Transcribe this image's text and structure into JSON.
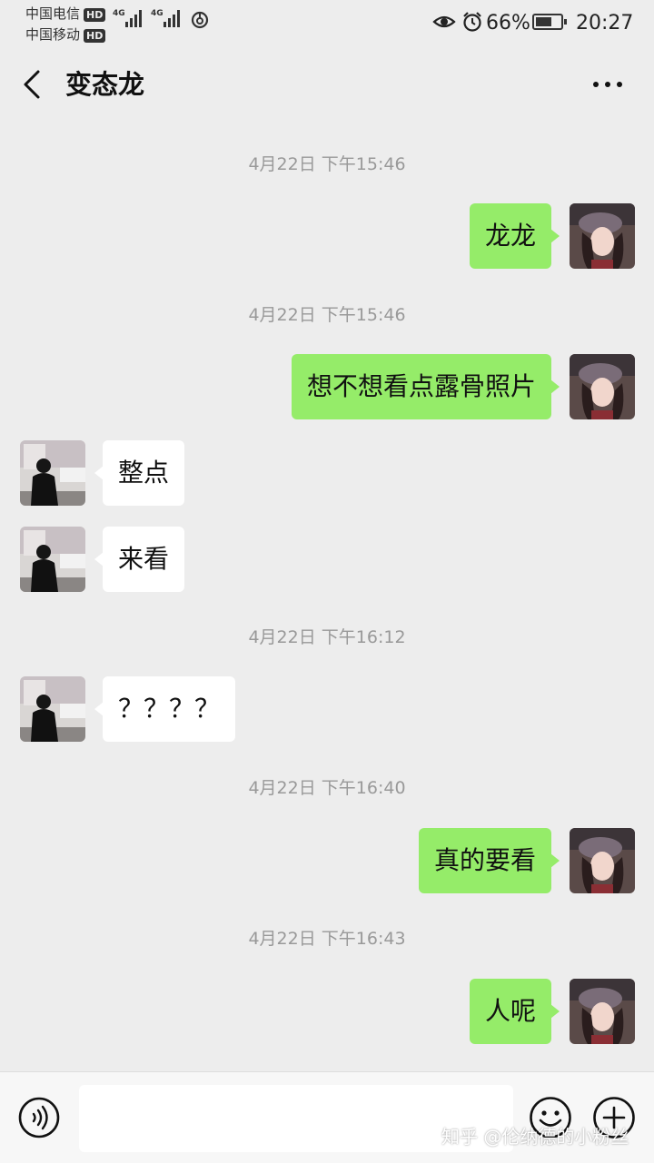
{
  "status_bar": {
    "carrier_1": "中国电信",
    "carrier_2": "中国移动",
    "hd_badge": "HD",
    "network": "4G",
    "battery": "66%",
    "battery_level": 0.66,
    "time": "20:27"
  },
  "header": {
    "title": "变态龙"
  },
  "messages": [
    {
      "type": "time",
      "text": "4月22日 下午15:46"
    },
    {
      "type": "msg",
      "from": "me",
      "text": "龙龙"
    },
    {
      "type": "time",
      "text": "4月22日 下午15:46"
    },
    {
      "type": "msg",
      "from": "me",
      "text": "想不想看点露骨照片"
    },
    {
      "type": "msg",
      "from": "them",
      "text": "整点"
    },
    {
      "type": "msg",
      "from": "them",
      "text": "来看"
    },
    {
      "type": "time",
      "text": "4月22日 下午16:12"
    },
    {
      "type": "msg",
      "from": "them",
      "text": "？？？？"
    },
    {
      "type": "time",
      "text": "4月22日 下午16:40"
    },
    {
      "type": "msg",
      "from": "me",
      "text": "真的要看"
    },
    {
      "type": "time",
      "text": "4月22日 下午16:43"
    },
    {
      "type": "msg",
      "from": "me",
      "text": "人呢"
    }
  ],
  "input": {
    "value": ""
  },
  "watermark": "知乎 @伦纳德的小粉丝",
  "colors": {
    "background": "#ededed",
    "my_bubble": "#95ec69",
    "their_bubble": "#ffffff",
    "timestamp": "#999999"
  }
}
